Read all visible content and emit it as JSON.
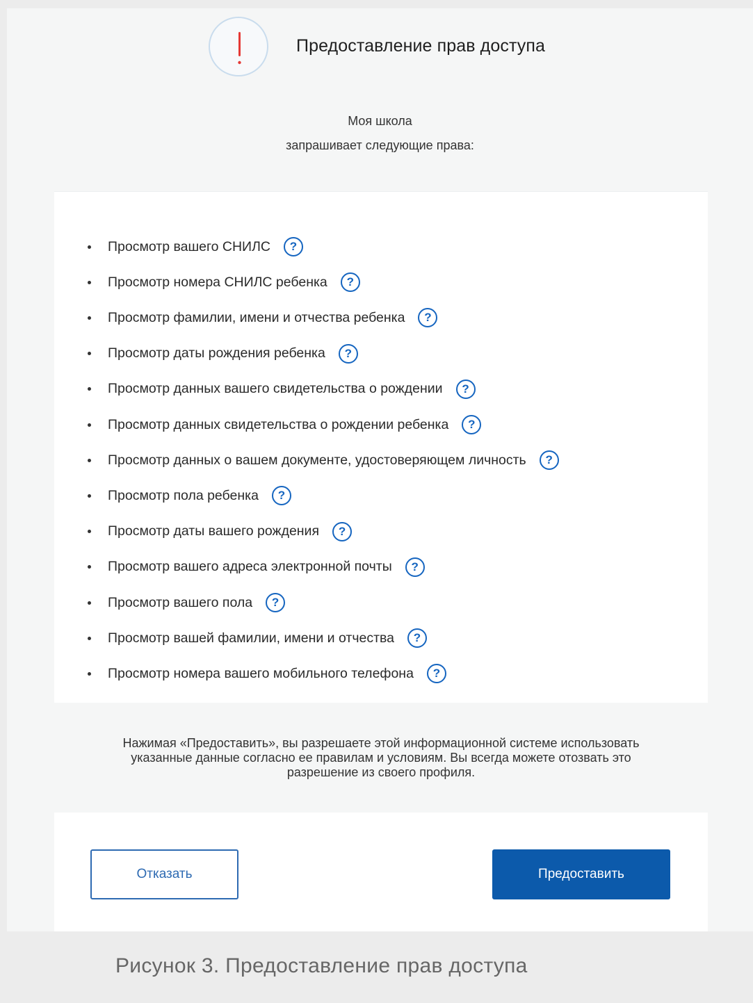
{
  "header": {
    "alert_icon": "exclamation-icon",
    "title": "Предоставление прав доступа"
  },
  "request": {
    "app_name": "Моя школа",
    "text": "запрашивает следующие права:"
  },
  "permissions": [
    "Просмотр вашего СНИЛС",
    "Просмотр номера СНИЛС ребенка",
    "Просмотр фамилии, имени и отчества ребенка",
    "Просмотр даты рождения ребенка",
    "Просмотр данных вашего свидетельства о рождении",
    "Просмотр данных свидетельства о рождении ребенка",
    "Просмотр данных о вашем документе, удостоверяющем личность",
    "Просмотр пола ребенка",
    "Просмотр даты вашего рождения",
    "Просмотр вашего адреса электронной почты",
    "Просмотр вашего пола",
    "Просмотр вашей фамилии, имени и отчества",
    "Просмотр номера вашего мобильного телефона"
  ],
  "help_symbol": "?",
  "notice": {
    "line1": "Нажимая «Предоставить», вы разрешаете этой информационной системе использовать",
    "line2": "указанные данные согласно ее правилам и условиям. Вы всегда можете отозвать это",
    "line3": "разрешение из своего профиля."
  },
  "buttons": {
    "decline": "Отказать",
    "grant": "Предоставить"
  },
  "caption": "Рисунок 3. Предоставление прав доступа",
  "colors": {
    "accent": "#0c5aab",
    "alert_red": "#e53935"
  }
}
